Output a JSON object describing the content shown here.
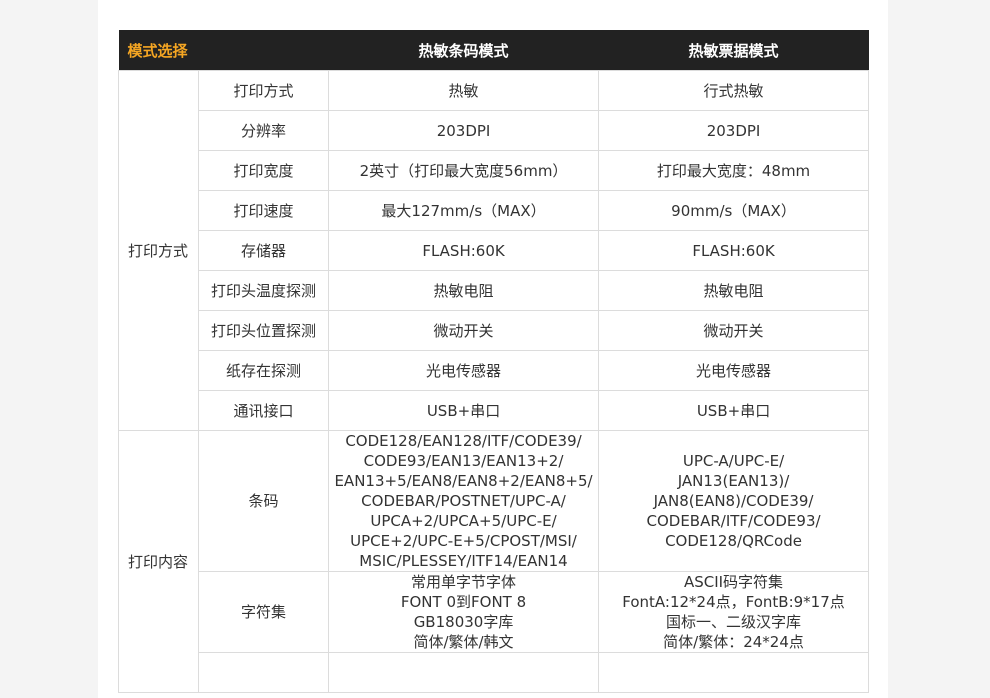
{
  "header": {
    "mode_label": "模式选择",
    "col_a": "热敏条码模式",
    "col_b": "热敏票据模式"
  },
  "group1": {
    "label": "打印方式",
    "rows": [
      {
        "name": "打印方式",
        "a": "热敏",
        "b": "行式热敏"
      },
      {
        "name": "分辨率",
        "a": "203DPI",
        "b": "203DPI"
      },
      {
        "name": "打印宽度",
        "a": "2英寸（打印最大宽度56mm）",
        "b": "打印最大宽度：48mm"
      },
      {
        "name": "打印速度",
        "a": "最大127mm/s（MAX）",
        "b": "90mm/s（MAX）"
      },
      {
        "name": "存储器",
        "a": "FLASH:60K",
        "b": "FLASH:60K"
      },
      {
        "name": "打印头温度探测",
        "a": "热敏电阻",
        "b": "热敏电阻"
      },
      {
        "name": "打印头位置探测",
        "a": "微动开关",
        "b": "微动开关"
      },
      {
        "name": "纸存在探测",
        "a": "光电传感器",
        "b": "光电传感器"
      },
      {
        "name": "通讯接口",
        "a": "USB+串口",
        "b": "USB+串口"
      }
    ]
  },
  "group2": {
    "label": "打印内容",
    "barcode": {
      "name": "条码",
      "a": [
        "CODE128/EAN128/ITF/CODE39/",
        "CODE93/EAN13/EAN13+2/",
        "EAN13+5/EAN8/EAN8+2/EAN8+5/",
        "CODEBAR/POSTNET/UPC-A/",
        "UPCA+2/UPCA+5/UPC-E/",
        "UPCE+2/UPC-E+5/CPOST/MSI/",
        "MSIC/PLESSEY/ITF14/EAN14"
      ],
      "b": [
        "UPC-A/UPC-E/",
        "JAN13(EAN13)/",
        "JAN8(EAN8)/CODE39/",
        "CODEBAR/ITF/CODE93/",
        "CODE128/QRCode"
      ]
    },
    "charset": {
      "name": "字符集",
      "a": [
        "常用单字节字体",
        "FONT 0到FONT 8",
        "GB18030字库",
        "简体/繁体/韩文"
      ],
      "b": [
        "ASCII码字符集",
        "FontA:12*24点，FontB:9*17点",
        "国标一、二级汉字库",
        "简体/繁体：24*24点"
      ]
    }
  }
}
